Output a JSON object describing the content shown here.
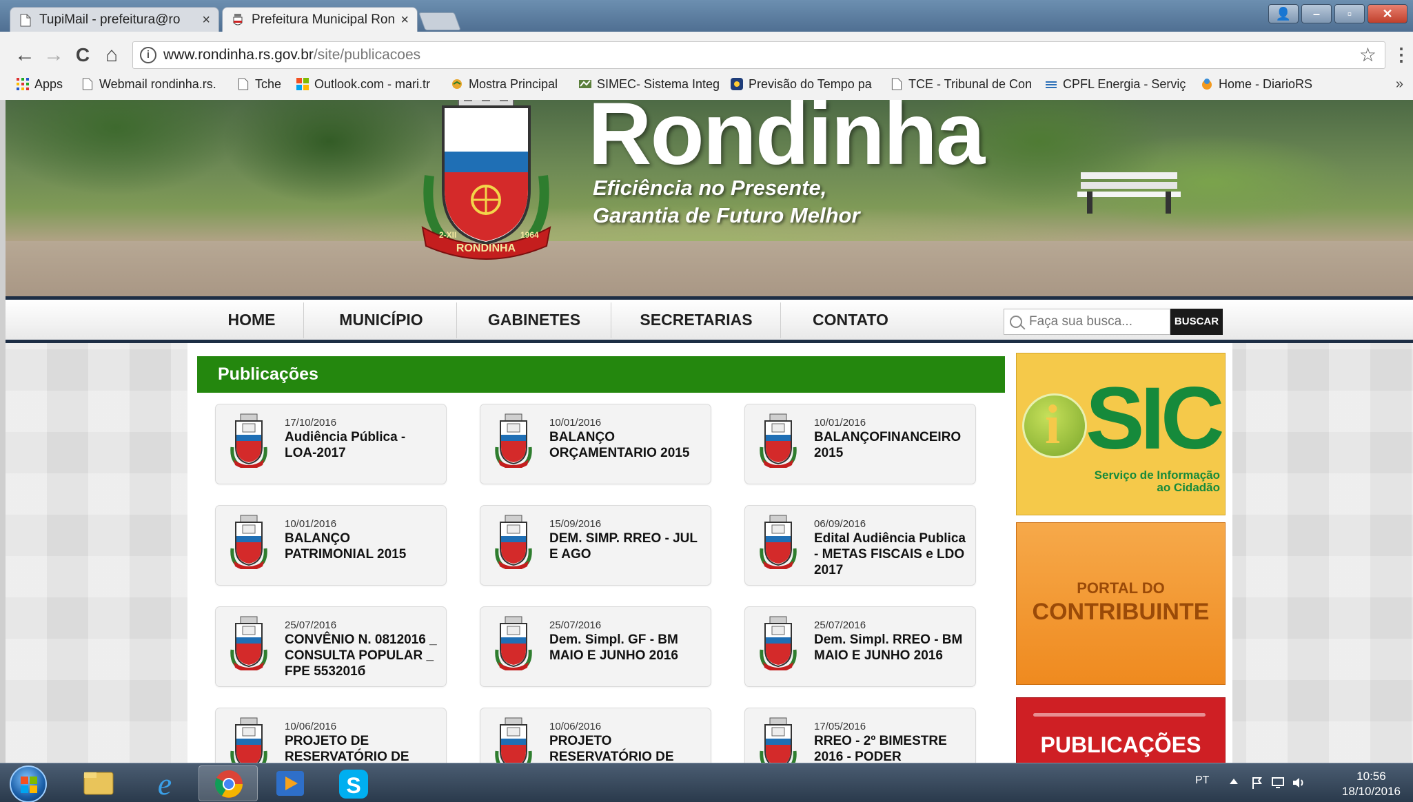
{
  "browser": {
    "tabs": [
      {
        "title": "TupiMail - prefeitura@ro",
        "active": false
      },
      {
        "title": "Prefeitura Municipal Ron",
        "active": true
      }
    ],
    "tab_close_glyph": "×",
    "url_host": "www.rondinha.rs.gov.br",
    "url_path": "/site/publicacoes",
    "back_icon": "←",
    "forward_icon": "→",
    "reload_icon": "C",
    "home_icon": "⌂",
    "star_icon": "☆",
    "bookmarks": [
      {
        "label": "Apps",
        "icon": "apps-grid-icon"
      },
      {
        "label": "Webmail rondinha.rs.",
        "icon": "page-icon"
      },
      {
        "label": "Tche",
        "icon": "page-icon"
      },
      {
        "label": "Outlook.com - mari.tr",
        "icon": "windows-logo-icon"
      },
      {
        "label": "Mostra Principal",
        "icon": "handshake-icon"
      },
      {
        "label": "SIMEC- Sistema Integ",
        "icon": "simec-icon"
      },
      {
        "label": "Previsão do Tempo pa",
        "icon": "weather-icon"
      },
      {
        "label": "TCE - Tribunal de Con",
        "icon": "page-icon"
      },
      {
        "label": "CPFL Energia - Serviç",
        "icon": "cpfl-icon"
      },
      {
        "label": "Home - DiarioRS",
        "icon": "diariors-icon"
      }
    ],
    "bookmarks_more": "»"
  },
  "site": {
    "town_name": "Rondinha",
    "crest_text": "RONDINHA",
    "crest_years": [
      "2-XII",
      "1964"
    ],
    "slogan_line1": "Eficiência no Presente,",
    "slogan_line2": "Garantia de Futuro Melhor",
    "nav": [
      "HOME",
      "MUNICÍPIO",
      "GABINETES",
      "SECRETARIAS",
      "CONTATO"
    ],
    "search_placeholder": "Faça sua busca...",
    "search_button": "BUSCAR",
    "section_title": "Publicações",
    "publications": [
      {
        "date": "17/10/2016",
        "title": "Audiência Pública - LOA-2017"
      },
      {
        "date": "10/01/2016",
        "title": "BALANÇO ORÇAMENTARIO 2015"
      },
      {
        "date": "10/01/2016",
        "title": "BALANÇOFINANCEIRO 2015"
      },
      {
        "date": "10/01/2016",
        "title": "BALANÇO PATRIMONIAL 2015"
      },
      {
        "date": "15/09/2016",
        "title": "DEM. SIMP. RREO - JUL E AGO"
      },
      {
        "date": "06/09/2016",
        "title": "Edital Audiência Publica - METAS FISCAIS e LDO 2017"
      },
      {
        "date": "25/07/2016",
        "title": "CONVÊNIO N. 0812016 _ CONSULTA POPULAR _ FPE 553201б"
      },
      {
        "date": "25/07/2016",
        "title": "Dem. Simpl. GF - BM MAIO E JUNHO 2016"
      },
      {
        "date": "25/07/2016",
        "title": "Dem. Simpl. RREO - BM MAIO E JUNHO 2016"
      },
      {
        "date": "10/06/2016",
        "title": "PROJETO DE RESERVATÓRIO DE"
      },
      {
        "date": "10/06/2016",
        "title": "PROJETO RESERVATÓRIO DE"
      },
      {
        "date": "17/05/2016",
        "title": "RREO - 2º BIMESTRE 2016 - PODER"
      }
    ],
    "sidebar": {
      "sic_title": "SIC",
      "sic_subtitle_1": "Serviço de Informação",
      "sic_subtitle_2": "ao Cidadão",
      "portal_line1": "PORTAL DO",
      "portal_line2": "CONTRIBUINTE",
      "publicacoes": "PUBLICAÇÕES"
    }
  },
  "taskbar": {
    "pinned": [
      "file-explorer-icon",
      "internet-explorer-icon",
      "chrome-icon",
      "media-player-icon",
      "skype-icon"
    ],
    "language": "PT",
    "time": "10:56",
    "date": "18/10/2016"
  },
  "colors": {
    "nav_border": "#1d2e45",
    "section_green": "#24870e",
    "sic_yellow": "#f5c94a",
    "portal_orange": "#ef8a1f",
    "publicacoes_red": "#cf1f24"
  }
}
